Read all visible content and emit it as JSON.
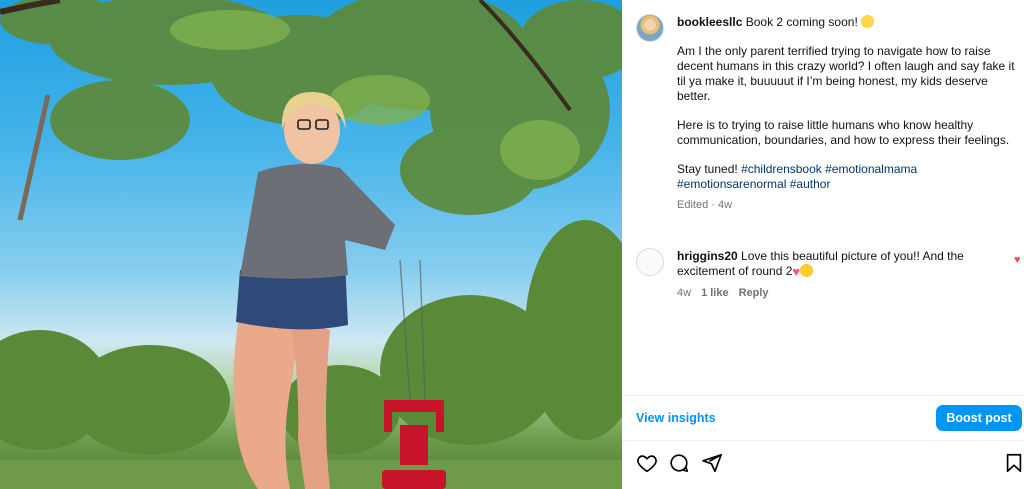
{
  "post": {
    "author": "bookleesllc",
    "headline": "Book 2 coming soon!",
    "paragraph_1": "Am I the only parent terrified trying to navigate how to raise decent humans in this crazy world? I often laugh and say fake it til ya make it, buuuuut if I’m being honest, my kids deserve better.",
    "paragraph_2": "Here is to trying to raise little humans who know healthy communication, boundaries, and how to express their feelings.",
    "paragraph_3_text": "Stay tuned!",
    "hashtags": [
      "#childrensbook",
      "#emotionalmama",
      "#emotionsarenormal",
      "#author"
    ],
    "edited": "Edited",
    "age": "4w",
    "emoji_headline": "star-struck-emoji"
  },
  "comment": {
    "author": "hriggins20",
    "text": "Love this beautiful picture of you!! And the excitement of round 2",
    "emojis": [
      "pink-heart-emoji",
      "hugging-face-emoji"
    ],
    "age": "4w",
    "likes": "1 like",
    "reply": "Reply"
  },
  "insights": {
    "view_label": "View insights",
    "boost_label": "Boost post"
  },
  "icons": {
    "like": "heart-icon",
    "comment": "comment-icon",
    "share": "send-icon",
    "save": "bookmark-icon",
    "comment_like": "heart-filled-icon"
  },
  "colors": {
    "accent": "#0095f6",
    "hashtag": "#00376b",
    "muted": "#737373",
    "like_red": "#ed4956"
  }
}
